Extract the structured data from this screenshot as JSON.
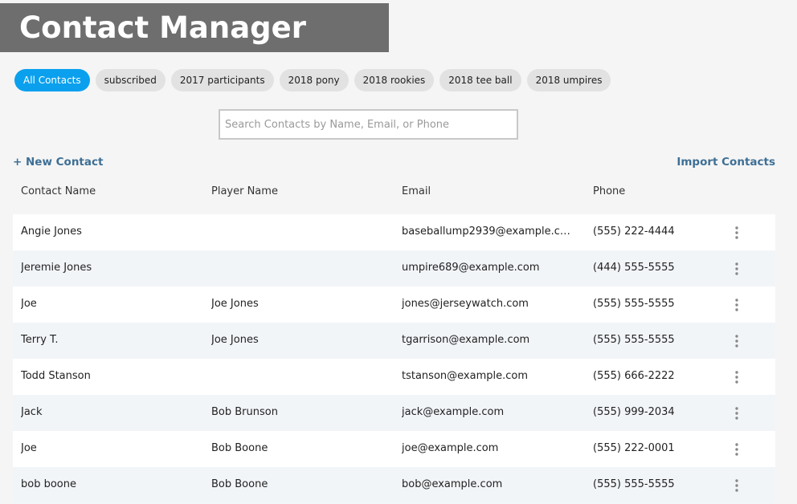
{
  "header": {
    "title": "Contact Manager"
  },
  "tags": [
    {
      "label": "All Contacts",
      "active": true
    },
    {
      "label": "subscribed",
      "active": false
    },
    {
      "label": "2017 participants",
      "active": false
    },
    {
      "label": "2018 pony",
      "active": false
    },
    {
      "label": "2018 rookies",
      "active": false
    },
    {
      "label": "2018 tee ball",
      "active": false
    },
    {
      "label": "2018 umpires",
      "active": false
    }
  ],
  "search": {
    "placeholder": "Search Contacts by Name, Email, or Phone",
    "value": ""
  },
  "actions": {
    "new_contact": "+ New Contact",
    "import_contacts": "Import Contacts"
  },
  "table": {
    "columns": [
      "Contact Name",
      "Player Name",
      "Email",
      "Phone"
    ],
    "rows": [
      {
        "contact": "Angie Jones",
        "player": "",
        "email": "baseballump2939@example.c…",
        "phone": "(555) 222-4444"
      },
      {
        "contact": "Jeremie Jones",
        "player": "",
        "email": "umpire689@example.com",
        "phone": "(444) 555-5555"
      },
      {
        "contact": "Joe",
        "player": "Joe Jones",
        "email": "jones@jerseywatch.com",
        "phone": "(555) 555-5555"
      },
      {
        "contact": "Terry T.",
        "player": "Joe Jones",
        "email": "tgarrison@example.com",
        "phone": "(555) 555-5555"
      },
      {
        "contact": "Todd Stanson",
        "player": "",
        "email": "tstanson@example.com",
        "phone": "(555) 666-2222"
      },
      {
        "contact": "Jack",
        "player": "Bob Brunson",
        "email": "jack@example.com",
        "phone": "(555) 999-2034"
      },
      {
        "contact": "Joe",
        "player": "Bob Boone",
        "email": "joe@example.com",
        "phone": "(555) 222-0001"
      },
      {
        "contact": "bob boone",
        "player": "Bob Boone",
        "email": "bob@example.com",
        "phone": "(555) 555-5555"
      }
    ]
  },
  "colors": {
    "accent": "#0aa0ee",
    "link": "#3e6f95",
    "banner": "#6e6e6e"
  },
  "icons": {
    "row_menu": "more-vertical-icon"
  }
}
